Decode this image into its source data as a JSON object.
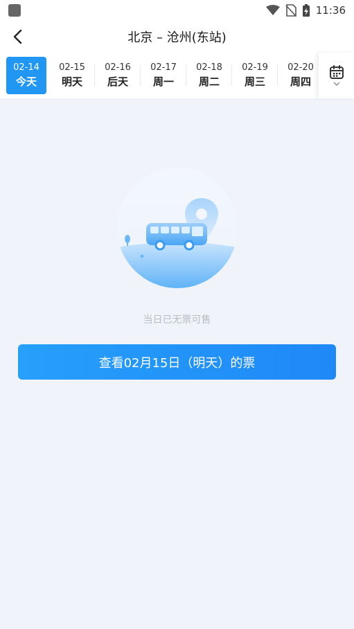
{
  "status": {
    "time": "11:36"
  },
  "header": {
    "title": "北京 – 沧州(东站)"
  },
  "dates": [
    {
      "date": "02-14",
      "label": "今天",
      "active": true
    },
    {
      "date": "02-15",
      "label": "明天",
      "active": false
    },
    {
      "date": "02-16",
      "label": "后天",
      "active": false
    },
    {
      "date": "02-17",
      "label": "周一",
      "active": false
    },
    {
      "date": "02-18",
      "label": "周二",
      "active": false
    },
    {
      "date": "02-19",
      "label": "周三",
      "active": false
    },
    {
      "date": "02-20",
      "label": "周四",
      "active": false
    }
  ],
  "icons": {
    "back": "back-arrow-icon",
    "calendar": "calendar-icon",
    "chevron": "chevron-down-icon"
  },
  "empty": {
    "message": "当日已无票可售"
  },
  "actions": {
    "next_day_label": "查看02月15日（明天）的票"
  },
  "colors": {
    "accent": "#2196f3",
    "background": "#f0f4fa"
  }
}
